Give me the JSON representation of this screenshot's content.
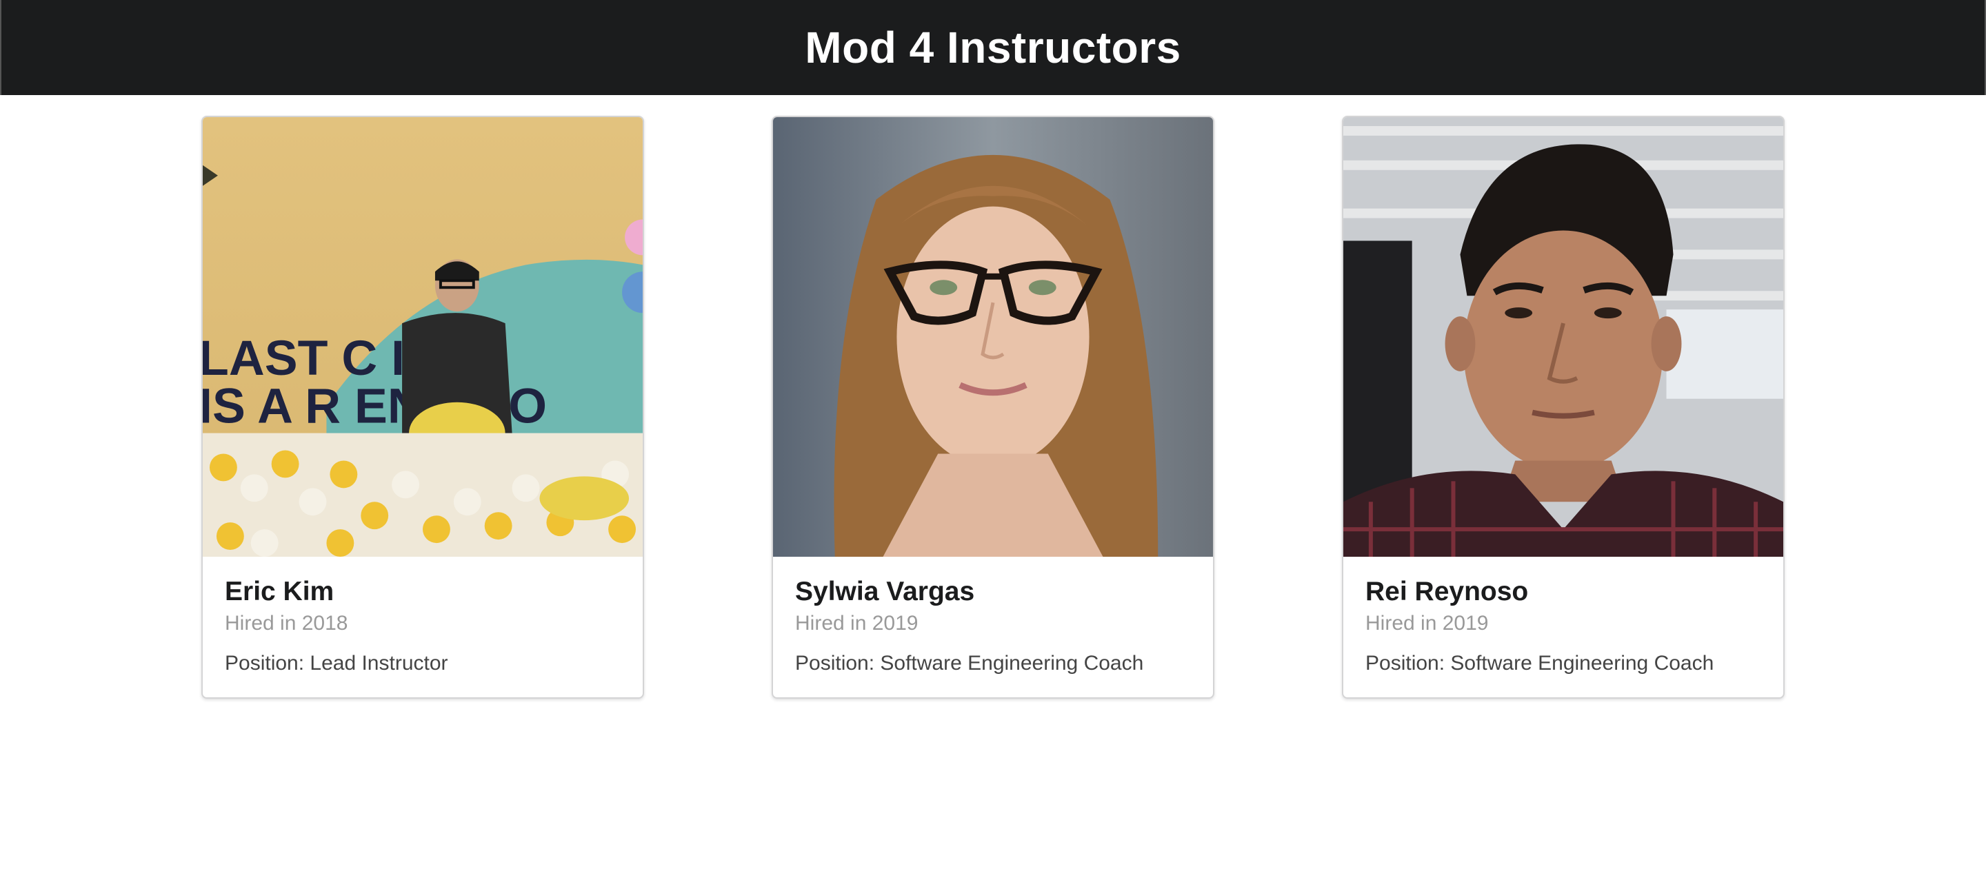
{
  "header": {
    "title": "Mod 4 Instructors"
  },
  "instructors": [
    {
      "name": "Eric Kim",
      "hired": "Hired in 2018",
      "position": "Position: Lead Instructor",
      "photo_text_line1": "LAST C IN",
      "photo_text_line2": "IS A R EN EGO"
    },
    {
      "name": "Sylwia Vargas",
      "hired": "Hired in 2019",
      "position": "Position: Software Engineering Coach"
    },
    {
      "name": "Rei Reynoso",
      "hired": "Hired in 2019",
      "position": "Position: Software Engineering Coach"
    }
  ]
}
